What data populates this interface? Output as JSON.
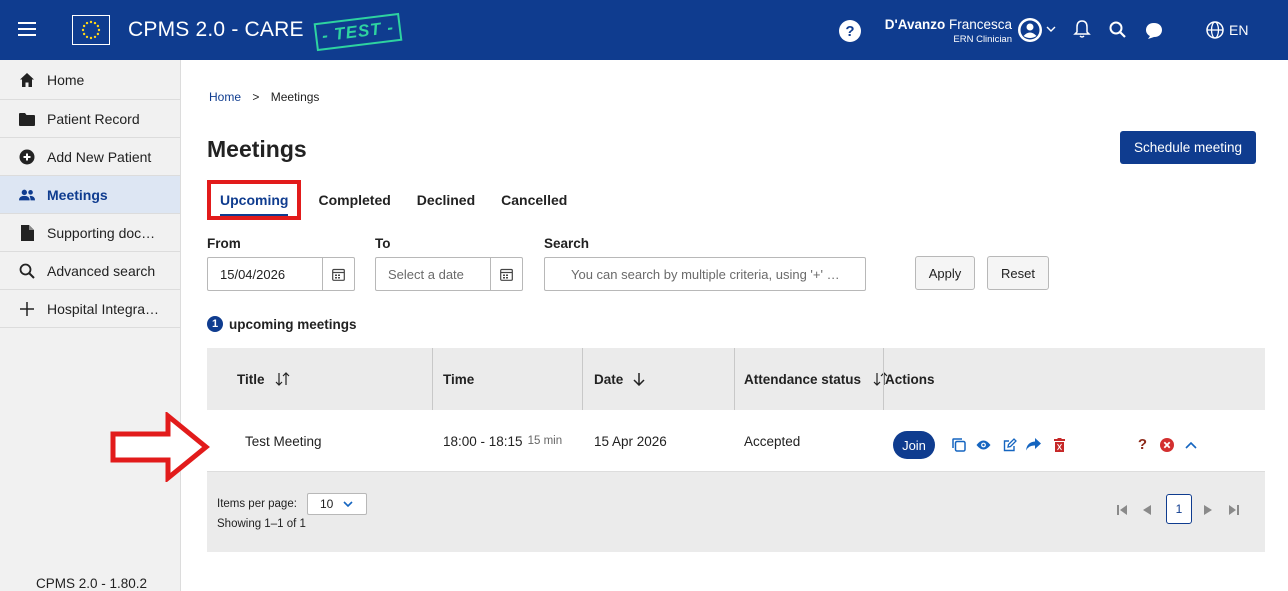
{
  "header": {
    "app_title": "CPMS 2.0 - CARE",
    "test_stamp": "TEST",
    "user_first": "D'Avanzo",
    "user_last": "Francesca",
    "user_role": "ERN Clinician",
    "language": "EN",
    "brand_color": "#0f3c8f"
  },
  "sidebar": {
    "items": [
      {
        "label": "Home",
        "icon": "home-icon"
      },
      {
        "label": "Patient Record",
        "icon": "folder-icon"
      },
      {
        "label": "Add New Patient",
        "icon": "plus-circle-icon"
      },
      {
        "label": "Meetings",
        "icon": "people-icon",
        "active": true
      },
      {
        "label": "Supporting doc…",
        "icon": "document-icon"
      },
      {
        "label": "Advanced search",
        "icon": "search-icon"
      },
      {
        "label": "Hospital Integra…",
        "icon": "plus-icon"
      }
    ],
    "version": "CPMS 2.0 - 1.80.2"
  },
  "breadcrumb": {
    "home": "Home",
    "separator": ">",
    "current": "Meetings"
  },
  "page": {
    "title": "Meetings",
    "schedule_button": "Schedule meeting",
    "tabs": [
      "Upcoming",
      "Completed",
      "Declined",
      "Cancelled"
    ],
    "active_tab": "Upcoming"
  },
  "filters": {
    "from_label": "From",
    "from_value": "15/04/2026",
    "to_label": "To",
    "to_placeholder": "Select a date",
    "search_label": "Search",
    "search_placeholder": "You can search by multiple criteria, using '+' …",
    "apply": "Apply",
    "reset": "Reset"
  },
  "summary": {
    "count": "1",
    "label": "upcoming meetings"
  },
  "table": {
    "headers": [
      "Title",
      "Time",
      "Date",
      "Attendance status",
      "Actions"
    ],
    "rows": [
      {
        "title": "Test Meeting",
        "time": "18:00 - 18:15",
        "duration": "15 min",
        "date": "15 Apr 2026",
        "status": "Accepted",
        "join": "Join"
      }
    ],
    "items_per_page_label": "Items per page:",
    "items_per_page": "10",
    "showing": "Showing 1–1 of 1",
    "current_page": "1"
  }
}
